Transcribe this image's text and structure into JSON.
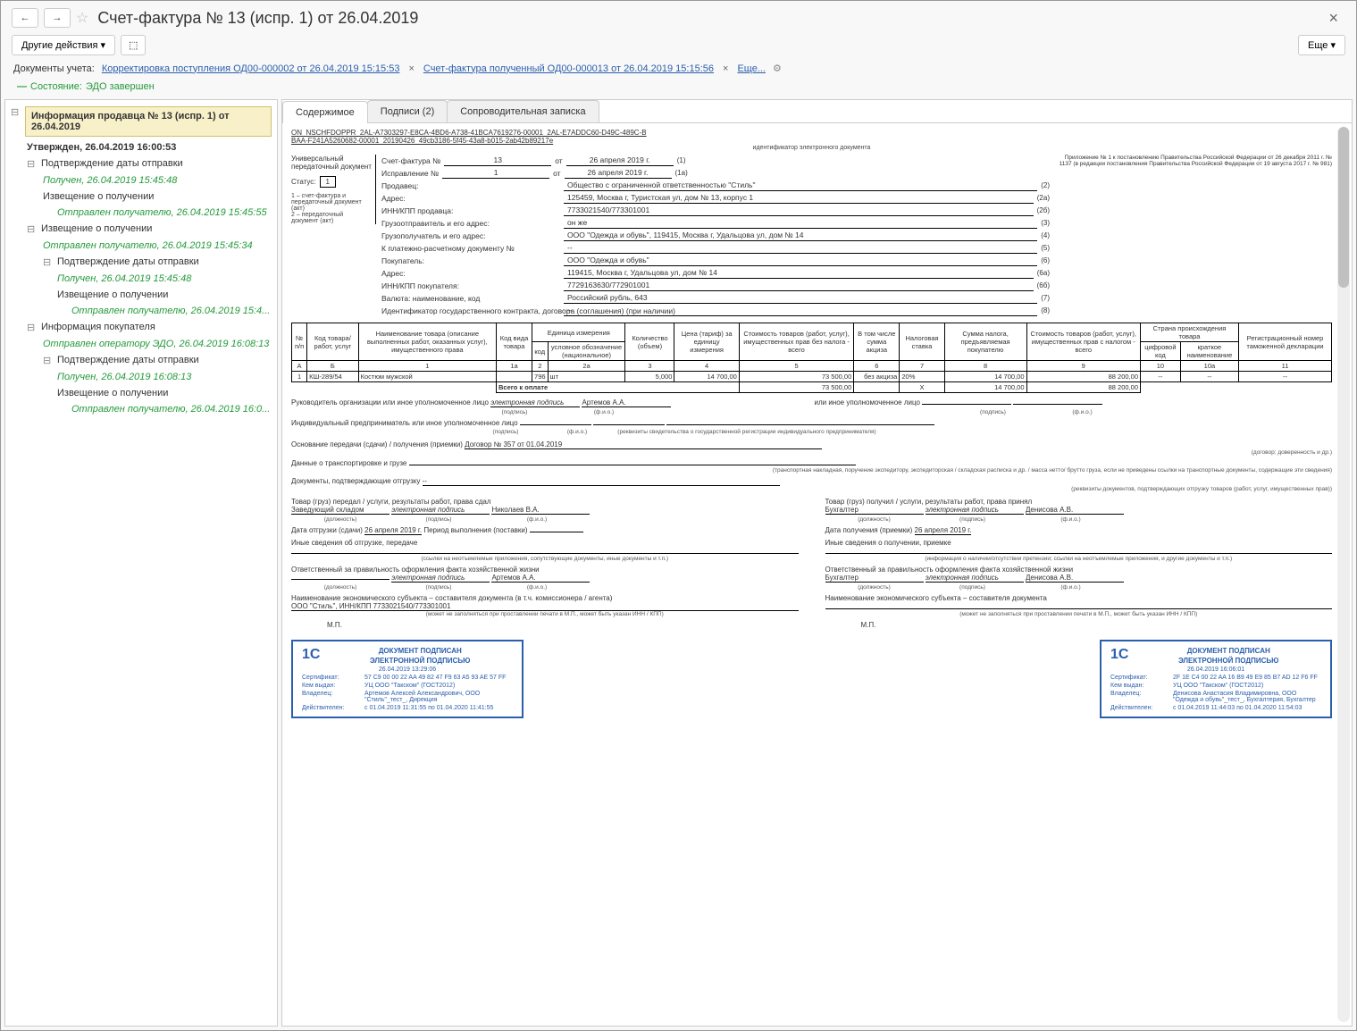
{
  "window": {
    "title": "Счет-фактура № 13 (испр. 1) от 26.04.2019"
  },
  "toolbar": {
    "other_actions": "Другие действия",
    "more": "Еще"
  },
  "doc_line": {
    "label": "Документы учета:",
    "link1": "Корректировка поступления ОД00-000002 от 26.04.2019 15:15:53",
    "link2": "Счет-фактура полученный ОД00-000013 от 26.04.2019 15:15:56",
    "more": "Еще..."
  },
  "status": {
    "label": "Состояние:",
    "value": "ЭДО завершен"
  },
  "tree": {
    "root": "Информация продавца № 13 (испр. 1) от 26.04.2019",
    "root_sub": "Утвержден, 26.04.2019 16:00:53",
    "n1": "Подтверждение даты отправки",
    "n1_d": "Получен, 26.04.2019 15:45:48",
    "n2": "Извещение о получении",
    "n2_d": "Отправлен получателю, 26.04.2019 15:45:55",
    "n3": "Извещение о получении",
    "n3_d": "Отправлен получателю, 26.04.2019 15:45:34",
    "n4": "Подтверждение даты отправки",
    "n4_d": "Получен, 26.04.2019 15:45:48",
    "n5": "Извещение о получении",
    "n5_d": "Отправлен получателю, 26.04.2019 15:4...",
    "n6": "Информация покупателя",
    "n6_d": "Отправлен оператору ЭДО, 26.04.2019 16:08:13",
    "n7": "Подтверждение даты отправки",
    "n7_d": "Получен, 26.04.2019 16:08:13",
    "n8": "Извещение о получении",
    "n8_d": "Отправлен получателю, 26.04.2019 16:0..."
  },
  "tabs": {
    "t1": "Содержимое",
    "t2": "Подписи (2)",
    "t3": "Сопроводительная записка"
  },
  "doc": {
    "id1": "ON_NSCHFDOPPR_2AL-A7303297-E8CA-4BD6-A738-41BCA7619276-00001_2AL-E7ADDC60-D49C-489C-B",
    "id2": "BAA-F241A5260682-00001_20190426_49cb3186-5f45-43a8-b015-2ab42b89217e",
    "id_sub": "идентификатор электронного документа",
    "upd_label": "Универсальный передаточный документ",
    "status_label": "Статус:",
    "status_value": "1",
    "footnote1": "1 – счет-фактура и передаточный документ (акт)",
    "footnote2": "2 – передаточный документ (акт)",
    "annex": "Приложение № 1 к постановлению Правительства Российской Федерации от 26 декабря 2011 г. № 1137 (в редакции постановления Правительства Российской Федерации от 19 августа 2017 г. № 981)",
    "sf_label": "Счет-фактура №",
    "sf_num": "13",
    "sf_ot": "от",
    "sf_date": "26 апреля 2019 г.",
    "sf_line": "(1)",
    "isp_label": "Исправление №",
    "isp_num": "1",
    "isp_ot": "от",
    "isp_date": "26 апреля 2019 г.",
    "isp_line": "(1а)",
    "seller_label": "Продавец:",
    "seller": "Общество с ограниченной ответственностью \"Стиль\"",
    "seller_line": "(2)",
    "addr_label": "Адрес:",
    "addr": "125459, Москва г, Туристская ул, дом № 13, корпус 1",
    "addr_line": "(2а)",
    "innkpp_s_label": "ИНН/КПП продавца:",
    "innkpp_s": "7733021540/773301001",
    "innkpp_s_line": "(2б)",
    "shipper_label": "Грузоотправитель и его адрес:",
    "shipper": "он же",
    "shipper_line": "(3)",
    "consignee_label": "Грузополучатель и его адрес:",
    "consignee": "ООО \"Одежда и обувь\", 119415, Москва г, Удальцова ул, дом № 14",
    "consignee_line": "(4)",
    "paydoc_label": "К платежно-расчетному документу №",
    "paydoc": "--",
    "paydoc_line": "(5)",
    "buyer_label": "Покупатель:",
    "buyer": "ООО \"Одежда и обувь\"",
    "buyer_line": "(6)",
    "buyer_addr_label": "Адрес:",
    "buyer_addr": "119415, Москва г, Удальцова ул, дом № 14",
    "buyer_addr_line": "(6а)",
    "innkpp_b_label": "ИНН/КПП покупателя:",
    "innkpp_b": "7729163630/772901001",
    "innkpp_b_line": "(6б)",
    "currency_label": "Валюта: наименование, код",
    "currency": "Российский рубль, 643",
    "currency_line": "(7)",
    "contract_label": "Идентификатор государственного контракта, договора (соглашения) (при наличии)",
    "contract": "--",
    "contract_line": "(8)"
  },
  "table": {
    "h_num": "№ п/п",
    "h_code": "Код товара/ работ, услуг",
    "h_name": "Наименование товара (описание выполненных работ, оказанных услуг), имущественного права",
    "h_type": "Код вида товара",
    "h_unit": "Единица измерения",
    "h_unit_code": "код",
    "h_unit_name": "условное обозначение (национальное)",
    "h_qty": "Количество (объем)",
    "h_price": "Цена (тариф) за единицу измерения",
    "h_cost": "Стоимость товаров (работ, услуг), имущественных прав без налога - всего",
    "h_excise": "В том числе сумма акциза",
    "h_rate": "Налоговая ставка",
    "h_tax": "Сумма налога, предъявляемая покупателю",
    "h_total": "Стоимость товаров (работ, услуг), имущественных прав с налогом - всего",
    "h_country": "Страна происхождения товара",
    "h_country_code": "цифровой код",
    "h_country_name": "краткое наименование",
    "h_gtd": "Регистрационный номер таможенной декларации",
    "sub_a": "А",
    "sub_b": "Б",
    "sub_1": "1",
    "sub_1a": "1а",
    "sub_2": "2",
    "sub_2a": "2а",
    "sub_3": "3",
    "sub_4": "4",
    "sub_5": "5",
    "sub_6": "6",
    "sub_7": "7",
    "sub_8": "8",
    "sub_9": "9",
    "sub_10": "10",
    "sub_10a": "10а",
    "sub_11": "11",
    "r1_num": "1",
    "r1_code": "КШ-289/54",
    "r1_name": "Костюм мужской",
    "r1_type": "",
    "r1_ucode": "796",
    "r1_uname": "шт",
    "r1_qty": "5,000",
    "r1_price": "14 700,00",
    "r1_cost": "73 500,00",
    "r1_excise": "без акциза",
    "r1_rate": "20%",
    "r1_tax": "14 700,00",
    "r1_total": "88 200,00",
    "r1_ccode": "--",
    "r1_cname": "--",
    "r1_gtd": "--",
    "total_label": "Всего к оплате",
    "total_cost": "73 500,00",
    "total_x": "Х",
    "total_tax": "14 700,00",
    "total_sum": "88 200,00"
  },
  "sig": {
    "head_label": "Руководитель организации или иное уполномоченное лицо",
    "esign": "электронная подпись",
    "head_name": "Артемов А.А.",
    "sub_sign": "(подпись)",
    "sub_fio": "(ф.и.о.)",
    "other_label": "или иное уполномоченное лицо",
    "ip_label": "Индивидуальный предприниматель или иное уполномоченное лицо",
    "ip_sub": "(реквизиты свидетельства о государственной регистрации индивидуального предпринимателя)",
    "basis_label": "Основание передачи (сдачи) / получения (приемки)",
    "basis_value": "Договор № 357 от 01.04.2019",
    "basis_sub": "(договор; доверенность и др.)",
    "transport_label": "Данные о транспортировке и грузе",
    "transport_sub": "(транспортная накладная, поручение экспедитору, экспедиторская / складская расписка и др. / масса нетто/ брутто груза, если не приведены ссылки на транспортные документы, содержащие эти сведения)",
    "confirm_label": "Документы, подтверждающие отгрузку",
    "confirm_value": "--",
    "confirm_sub": "(реквизиты документов, подтверждающих отгрузку товаров (работ, услуг, имущественных прав))"
  },
  "left_col": {
    "l1": "Товар (груз) передал / услуги, результаты работ, права сдал",
    "role": "Заведующий складом",
    "esign": "электронная подпись",
    "name": "Николаев В.А.",
    "sub_role": "(должность)",
    "sub_sign": "(подпись)",
    "sub_fio": "(ф.и.о.)",
    "date_label": "Дата отгрузки (сдачи)",
    "date": "26 апреля 2019 г.",
    "period_label": "Период выполнения (поставки)",
    "other_label": "Иные сведения об отгрузке, передаче",
    "other_sub": "(ссылки на неотъемлемые приложения, сопутствующие документы, иные документы и т.п.)",
    "resp_label": "Ответственный за правильность оформления факта хозяйственной жизни",
    "resp_name": "Артемов А.А.",
    "org_label": "Наименование экономического субъекта – составителя документа (в т.ч. комиссионера / агента)",
    "org_value": "ООО \"Стиль\", ИНН/КПП 7733021540/773301001",
    "org_sub": "(может не заполняться при проставлении печати в М.П., может быть указан ИНН / КПП)",
    "mp": "М.П."
  },
  "right_col": {
    "l1": "Товар (груз) получил / услуги, результаты работ, права принял",
    "role": "Бухгалтер",
    "esign": "электронная подпись",
    "name": "Денисова А.В.",
    "sub_role": "(должность)",
    "sub_sign": "(подпись)",
    "sub_fio": "(ф.и.о.)",
    "date_label": "Дата получения (приемки)",
    "date": "26 апреля 2019 г.",
    "other_label": "Иные сведения о получении, приемке",
    "other_sub": "(информация о наличии/отсутствии претензии; ссылки на неотъемлемые приложения, и другие документы и т.п.)",
    "resp_label": "Ответственный за правильность оформления факта хозяйственной жизни",
    "resp_role": "Бухгалтер",
    "resp_name": "Денисова А.В.",
    "org_label": "Наименование экономического субъекта – составителя документа",
    "org_sub": "(может не заполняться при проставлении печати в М.П., может быть указан ИНН / КПП)",
    "mp": "М.П."
  },
  "stamp1": {
    "logo": "1С",
    "title1": "ДОКУМЕНТ ПОДПИСАН",
    "title2": "ЭЛЕКТРОННОЙ ПОДПИСЬЮ",
    "date": "26.04.2019 13:29:06",
    "cert_l": "Сертификат:",
    "cert": "57 C9 00 00 22 AA 49 82 47 F9 63 A5 93 AE 57 FF",
    "issuer_l": "Кем выдан:",
    "issuer": "УЦ ООО \"Такском\" (ГОСТ2012)",
    "owner_l": "Владелец:",
    "owner": "Артемов Алексей Александрович, ООО \"Стиль\"_тест_, Дирекция",
    "valid_l": "Действителен:",
    "valid": "с 01.04.2019 11:31:55 по 01.04.2020 11:41:55"
  },
  "stamp2": {
    "logo": "1С",
    "title1": "ДОКУМЕНТ ПОДПИСАН",
    "title2": "ЭЛЕКТРОННОЙ ПОДПИСЬЮ",
    "date": "26.04.2019 16:06:01",
    "cert_l": "Сертификат:",
    "cert": "2F 1E C4 00 22 AA 16 B9 49 E9 85 B7 AD 12 F6 FF",
    "issuer_l": "Кем выдан:",
    "issuer": "УЦ ООО \"Такском\" (ГОСТ2012)",
    "owner_l": "Владелец:",
    "owner": "Денисова Анастасия Владимировна, ООО \"Одежда и обувь\"_тест_, Бухгалтерия, Бухгалтер",
    "valid_l": "Действителен:",
    "valid": "с 01.04.2019 11:44:03 по 01.04.2020 11:54:03"
  }
}
